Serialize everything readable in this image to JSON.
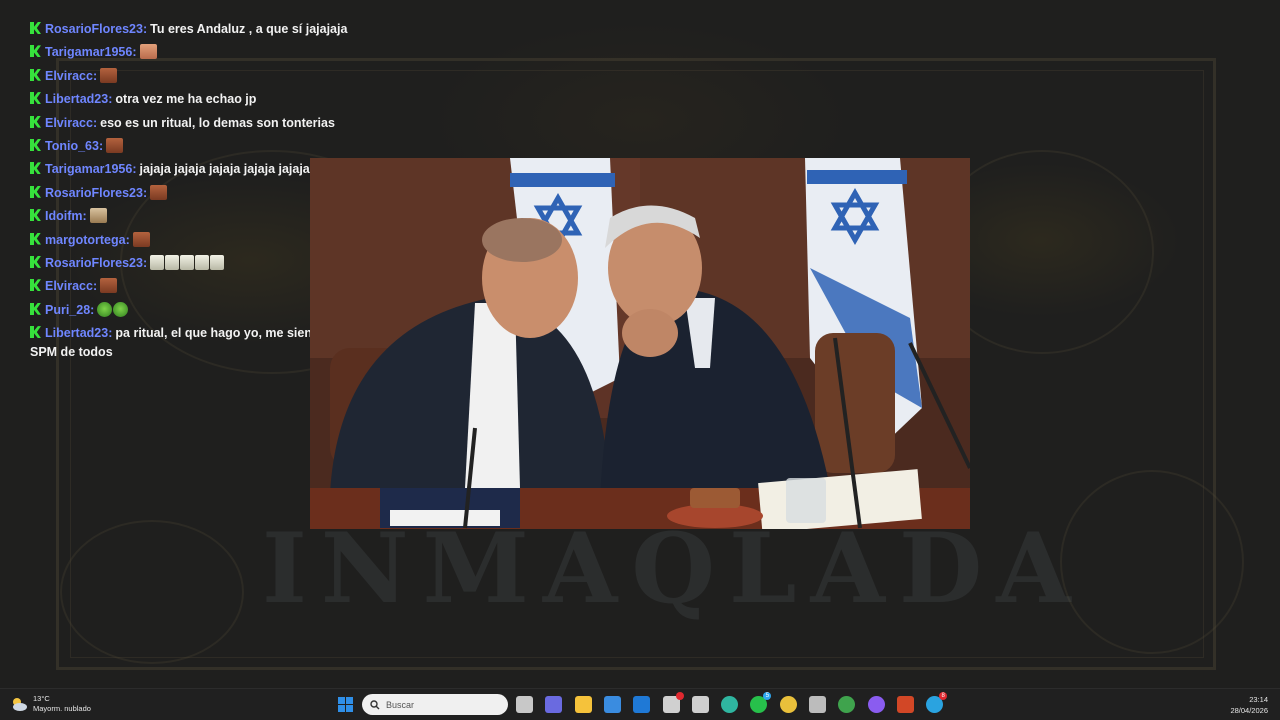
{
  "chat": [
    {
      "user": "RosarioFlores23",
      "text": "Tu eres Andaluz , a que sí jajajaja",
      "emotes": []
    },
    {
      "user": "Tarigamar1956",
      "text": "",
      "emotes": [
        "face2"
      ]
    },
    {
      "user": "Elviracc",
      "text": "",
      "emotes": [
        "face"
      ]
    },
    {
      "user": "Libertad23",
      "text": "otra vez me ha echao jp",
      "emotes": []
    },
    {
      "user": "Elviracc",
      "text": "eso es un ritual, lo demas son tonterias",
      "emotes": []
    },
    {
      "user": "Tonio_63",
      "text": "",
      "emotes": [
        "face"
      ]
    },
    {
      "user": "Tarigamar1956",
      "text": "jajaja jajaja jajaja jajaja jajaja",
      "emotes": []
    },
    {
      "user": "RosarioFlores23",
      "text": "",
      "emotes": [
        "face"
      ]
    },
    {
      "user": "Idoifm",
      "text": "",
      "emotes": [
        "face3"
      ]
    },
    {
      "user": "margotortega",
      "text": "",
      "emotes": [
        "face"
      ]
    },
    {
      "user": "RosarioFlores23",
      "text": "",
      "emotes": [
        "skull",
        "skull",
        "skull",
        "skull",
        "skull"
      ]
    },
    {
      "user": "Elviracc",
      "text": "",
      "emotes": [
        "face"
      ]
    },
    {
      "user": "Puri_28",
      "text": "",
      "emotes": [
        "frog",
        "frog"
      ]
    },
    {
      "user": "Libertad23",
      "text": "pa ritual, el que hago yo, me siento en el bater y me cago en SPM de todos",
      "emotes": []
    }
  ],
  "watermark": "INMAQLADA",
  "taskbar": {
    "weather": {
      "temp": "13°C",
      "desc": "Mayorm. nublado",
      "icon": "cloud-sun-icon"
    },
    "search_placeholder": "Buscar",
    "clock": {
      "time": "23:14",
      "date": "28/04/2026"
    },
    "apps": [
      {
        "name": "windows-start-icon",
        "color": "#2f8fe8"
      },
      {
        "name": "task-view-icon",
        "color": "#c8c8c8"
      },
      {
        "name": "teams-icon",
        "color": "#6a6ae0"
      },
      {
        "name": "file-explorer-icon",
        "color": "#f5c23b"
      },
      {
        "name": "ms-store-icon",
        "color": "#3a8ce0"
      },
      {
        "name": "outlook-icon",
        "color": "#1f79d6"
      },
      {
        "name": "obs-icon",
        "color": "#d0d0d0",
        "badge": "#e0282f"
      },
      {
        "name": "unity-icon",
        "color": "#cfcfcf"
      },
      {
        "name": "edge-icon",
        "color": "#2fb6a0"
      },
      {
        "name": "whatsapp-icon",
        "color": "#27c04b",
        "badge": "#2fa7f0",
        "badge_text": "5"
      },
      {
        "name": "chrome-icon",
        "color": "#e9c03b"
      },
      {
        "name": "steam-icon",
        "color": "#bcbcbc"
      },
      {
        "name": "chrome-profile-icon",
        "color": "#3fa34d"
      },
      {
        "name": "circle-app-icon",
        "color": "#8a5cf0"
      },
      {
        "name": "powerpoint-icon",
        "color": "#d24726"
      },
      {
        "name": "telegram-icon",
        "color": "#2aa3e0",
        "badge": "#e0282f",
        "badge_text": "8"
      }
    ]
  }
}
